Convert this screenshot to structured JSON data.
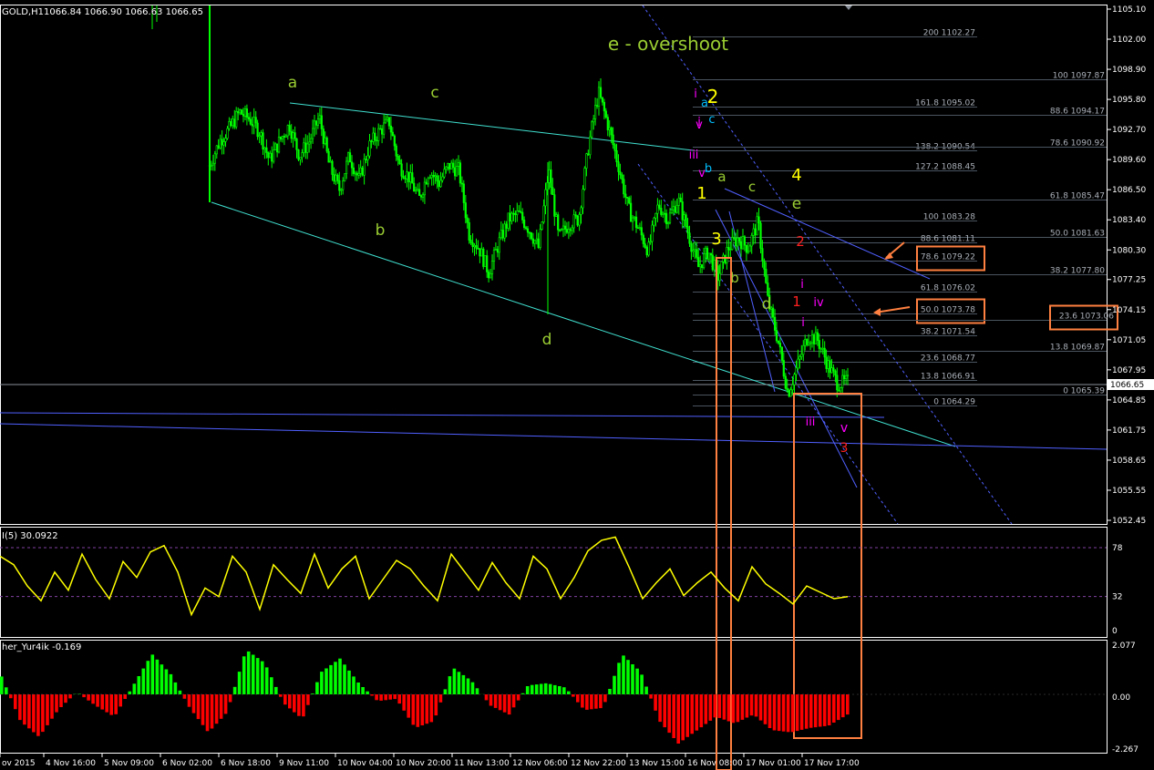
{
  "window": {
    "title_symbol": "GOLD,H1",
    "title_ohlc": "1066.84 1066.90 1066.63 1066.65"
  },
  "colors": {
    "background": "#000000",
    "candle": "#00ff00",
    "wave_label": "#9acd32",
    "yellow_label": "#ffff00",
    "magenta_label": "#ff00ff",
    "red_label": "#ff2020",
    "cyan_label": "#00bfff",
    "channel_cyan": "#40e0d0",
    "trend_blue": "#5060ff",
    "fib_line": "#4b5560",
    "orange_box": "#ff8040",
    "rsi_line": "#ffff00",
    "hist_up": "#00ff00",
    "hist_down": "#ff0000"
  },
  "chart_data": {
    "type": "candlestick",
    "symbol": "GOLD",
    "timeframe": "H1",
    "last_price": "1066.65",
    "ylim": [
      1052.45,
      1105.1
    ],
    "y_ticks": [
      "1105.10",
      "1102.00",
      "1098.90",
      "1095.80",
      "1092.70",
      "1089.60",
      "1086.50",
      "1083.40",
      "1080.30",
      "1077.25",
      "1074.15",
      "1071.05",
      "1067.95",
      "1064.85",
      "1061.75",
      "1058.65",
      "1055.55",
      "1052.45"
    ],
    "x_ticks": [
      "ov 2015",
      "4 Nov 16:00",
      "5 Nov 09:00",
      "6 Nov 02:00",
      "6 Nov 18:00",
      "9 Nov 11:00",
      "10 Nov 04:00",
      "10 Nov 20:00",
      "11 Nov 13:00",
      "12 Nov 06:00",
      "12 Nov 22:00",
      "13 Nov 15:00",
      "16 Nov 08:00",
      "17 Nov 01:00",
      "17 Nov 17:00"
    ],
    "price_path": [
      1089,
      1091.5,
      1092.8,
      1094.5,
      1093.8,
      1092.5,
      1089.5,
      1091.5,
      1093.2,
      1090,
      1091.5,
      1094,
      1089,
      1086.5,
      1090,
      1087.5,
      1091,
      1092.5,
      1093.5,
      1089,
      1087.8,
      1085.5,
      1088.5,
      1087.2,
      1089,
      1088.5,
      1082,
      1080.5,
      1078,
      1081,
      1083.5,
      1084,
      1082.5,
      1080.5,
      1088.5,
      1081.5,
      1083,
      1083.5,
      1091,
      1096.5,
      1093,
      1089,
      1084.5,
      1082.5,
      1080.2,
      1085,
      1083.5,
      1085.5,
      1082,
      1078.5,
      1080.2,
      1077.5,
      1080.5,
      1081.5,
      1080.5,
      1083.2,
      1075,
      1071,
      1065.5,
      1068.5,
      1071.5,
      1071,
      1068.5,
      1066.5,
      1066.7
    ],
    "fib_levels": [
      {
        "label": "200 1102.27",
        "value": 1102.27
      },
      {
        "label": "100 1097.87",
        "value": 1097.87
      },
      {
        "label": "161.8 1095.02",
        "value": 1095.02
      },
      {
        "label": "88.6 1094.17",
        "value": 1094.17
      },
      {
        "label": "138.2 1090.54",
        "value": 1090.54
      },
      {
        "label": "78.6 1090.92",
        "value": 1090.92
      },
      {
        "label": "127.2 1088.45",
        "value": 1088.45
      },
      {
        "label": "61.8 1085.47",
        "value": 1085.47
      },
      {
        "label": "100 1083.28",
        "value": 1083.28
      },
      {
        "label": "50.0 1081.63",
        "value": 1081.63
      },
      {
        "label": "88.6 1081.11",
        "value": 1081.11
      },
      {
        "label": "78.6 1079.22",
        "value": 1079.22
      },
      {
        "label": "38.2 1077.80",
        "value": 1077.8
      },
      {
        "label": "61.8 1076.02",
        "value": 1076.02
      },
      {
        "label": "50.0 1073.78",
        "value": 1073.78
      },
      {
        "label": "23.6 1073.06",
        "value": 1073.06
      },
      {
        "label": "38.2 1071.54",
        "value": 1071.54
      },
      {
        "label": "13.8 1069.87",
        "value": 1069.87
      },
      {
        "label": "23.6 1068.77",
        "value": 1068.77
      },
      {
        "label": "13.8 1066.91",
        "value": 1066.91
      },
      {
        "label": "0 1065.39",
        "value": 1065.39
      },
      {
        "label": "0 1064.29",
        "value": 1064.29
      }
    ],
    "wave_labels": [
      {
        "text": "e - overshoot",
        "group": "olive"
      },
      {
        "text": "a",
        "group": "olive"
      },
      {
        "text": "c",
        "group": "olive"
      },
      {
        "text": "b",
        "group": "olive"
      },
      {
        "text": "d",
        "group": "olive"
      },
      {
        "text": "2",
        "group": "yellow"
      },
      {
        "text": "i",
        "group": "magenta"
      },
      {
        "text": "a",
        "group": "cyan"
      },
      {
        "text": "c",
        "group": "cyan"
      },
      {
        "text": "i",
        "group": "magenta"
      },
      {
        "text": "v",
        "group": "magenta"
      },
      {
        "text": "iii",
        "group": "magenta"
      },
      {
        "text": "b",
        "group": "cyan"
      },
      {
        "text": "v",
        "group": "magenta"
      },
      {
        "text": "a",
        "group": "olive"
      },
      {
        "text": "1",
        "group": "yellow"
      },
      {
        "text": "c",
        "group": "olive"
      },
      {
        "text": "4",
        "group": "yellow"
      },
      {
        "text": "e",
        "group": "olive"
      },
      {
        "text": "3",
        "group": "yellow"
      },
      {
        "text": "2",
        "group": "red"
      },
      {
        "text": "b",
        "group": "olive"
      },
      {
        "text": "d",
        "group": "olive"
      },
      {
        "text": "1",
        "group": "red"
      },
      {
        "text": "iv",
        "group": "magenta"
      },
      {
        "text": "i",
        "group": "magenta"
      },
      {
        "text": "i",
        "group": "magenta"
      },
      {
        "text": "iii",
        "group": "magenta"
      },
      {
        "text": "v",
        "group": "magenta"
      },
      {
        "text": "3",
        "group": "red"
      }
    ],
    "highlighted_levels": [
      "78.6 1079.22",
      "50.0 1073.78",
      "23.6 1073.06"
    ]
  },
  "rsi_panel": {
    "label": "I(5) 30.0922",
    "ticks": [
      "78",
      "32",
      "0"
    ],
    "current": 30.0922,
    "values": [
      70,
      62,
      42,
      28,
      55,
      38,
      72,
      48,
      30,
      65,
      50,
      74,
      80,
      55,
      15,
      40,
      32,
      70,
      55,
      20,
      62,
      48,
      35,
      72,
      40,
      58,
      70,
      30,
      48,
      66,
      58,
      42,
      28,
      72,
      55,
      38,
      64,
      45,
      30,
      70,
      58,
      30,
      50,
      75,
      85,
      88,
      60,
      30,
      45,
      58,
      33,
      45,
      55,
      40,
      28,
      60,
      44,
      35,
      25,
      42,
      36,
      30,
      32
    ]
  },
  "hist_panel": {
    "label": "her_Yur4ik -0.169",
    "ticks": [
      "2.077",
      "0.00",
      "-2.267"
    ],
    "current": -0.169,
    "values": [
      0.8,
      -1.2,
      -1.9,
      -0.7,
      0.1,
      -0.5,
      -1.0,
      0.4,
      1.8,
      0.9,
      -0.6,
      -1.7,
      -0.8,
      2.0,
      1.4,
      -0.4,
      -1.1,
      1.0,
      1.6,
      0.5,
      -0.3,
      -0.2,
      -1.5,
      -1.2,
      1.2,
      0.6,
      -0.5,
      -0.9,
      0.4,
      0.5,
      0.3,
      -0.7,
      -0.6,
      1.8,
      1.0,
      -1.2,
      -2.2,
      -1.6,
      -1.0,
      -1.3,
      -0.9,
      -1.6,
      -1.7,
      -1.5,
      -1.4,
      -0.9
    ]
  }
}
